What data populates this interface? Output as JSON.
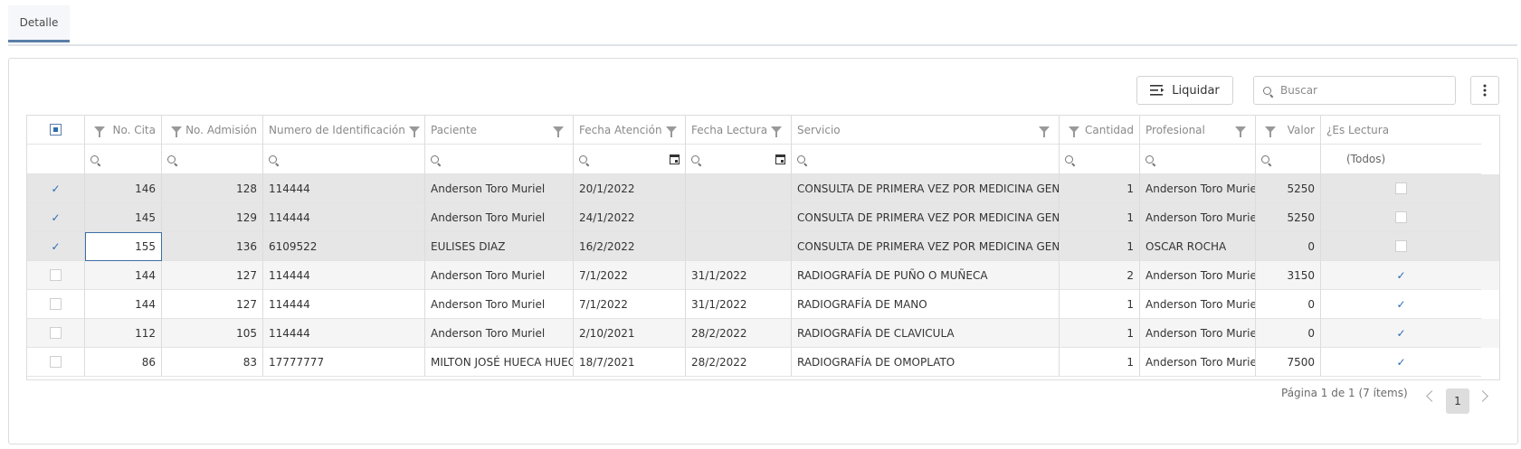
{
  "tabs": [
    {
      "label": "Detalle"
    }
  ],
  "toolbar": {
    "liquidar_label": "Liquidar",
    "search_placeholder": "Buscar"
  },
  "grid": {
    "columns": [
      {
        "key": "select",
        "label": ""
      },
      {
        "key": "cita",
        "label": "No. Cita"
      },
      {
        "key": "admision",
        "label": "No. Admisión"
      },
      {
        "key": "identificacion",
        "label": "Numero de Identificación"
      },
      {
        "key": "paciente",
        "label": "Paciente"
      },
      {
        "key": "fecha_atencion",
        "label": "Fecha Atención"
      },
      {
        "key": "fecha_lectura",
        "label": "Fecha Lectura"
      },
      {
        "key": "servicio",
        "label": "Servicio"
      },
      {
        "key": "cantidad",
        "label": "Cantidad"
      },
      {
        "key": "profesional",
        "label": "Profesional"
      },
      {
        "key": "valor",
        "label": "Valor"
      },
      {
        "key": "es_lectura",
        "label": "¿Es Lectura"
      }
    ],
    "lectura_filter": "(Todos)",
    "rows": [
      {
        "selected": true,
        "cita": "146",
        "admision": "128",
        "identificacion": "114444",
        "paciente": "Anderson Toro Muriel",
        "fecha_atencion": "20/1/2022",
        "fecha_lectura": "",
        "servicio": "CONSULTA DE PRIMERA VEZ POR MEDICINA GENERAL",
        "cantidad": "1",
        "profesional": "Anderson Toro Muriel",
        "valor": "5250",
        "es_lectura": false
      },
      {
        "selected": true,
        "cita": "145",
        "admision": "129",
        "identificacion": "114444",
        "paciente": "Anderson Toro Muriel",
        "fecha_atencion": "24/1/2022",
        "fecha_lectura": "",
        "servicio": "CONSULTA DE PRIMERA VEZ POR MEDICINA GENERAL",
        "cantidad": "1",
        "profesional": "Anderson Toro Muriel",
        "valor": "5250",
        "es_lectura": false
      },
      {
        "selected": true,
        "cita": "155",
        "admision": "136",
        "identificacion": "6109522",
        "paciente": "EULISES DIAZ",
        "fecha_atencion": "16/2/2022",
        "fecha_lectura": "",
        "servicio": "CONSULTA DE PRIMERA VEZ POR MEDICINA GENERAL",
        "cantidad": "1",
        "profesional": "OSCAR ROCHA",
        "valor": "0",
        "es_lectura": false
      },
      {
        "selected": false,
        "cita": "144",
        "admision": "127",
        "identificacion": "114444",
        "paciente": "Anderson Toro Muriel",
        "fecha_atencion": "7/1/2022",
        "fecha_lectura": "31/1/2022",
        "servicio": "RADIOGRAFÍA DE PUÑO O MUÑECA",
        "cantidad": "2",
        "profesional": "Anderson Toro Muriel",
        "valor": "3150",
        "es_lectura": true
      },
      {
        "selected": false,
        "cita": "144",
        "admision": "127",
        "identificacion": "114444",
        "paciente": "Anderson Toro Muriel",
        "fecha_atencion": "7/1/2022",
        "fecha_lectura": "31/1/2022",
        "servicio": "RADIOGRAFÍA DE MANO",
        "cantidad": "1",
        "profesional": "Anderson Toro Muriel",
        "valor": "0",
        "es_lectura": true
      },
      {
        "selected": false,
        "cita": "112",
        "admision": "105",
        "identificacion": "114444",
        "paciente": "Anderson Toro Muriel",
        "fecha_atencion": "2/10/2021",
        "fecha_lectura": "28/2/2022",
        "servicio": "RADIOGRAFÍA DE CLAVICULA",
        "cantidad": "1",
        "profesional": "Anderson Toro Muriel",
        "valor": "0",
        "es_lectura": true
      },
      {
        "selected": false,
        "cita": "86",
        "admision": "83",
        "identificacion": "17777777",
        "paciente": "MILTON JOSÉ HUECA HUECA",
        "fecha_atencion": "18/7/2021",
        "fecha_lectura": "28/2/2022",
        "servicio": "RADIOGRAFÍA DE OMOPLATO",
        "cantidad": "1",
        "profesional": "Anderson Toro Muriel",
        "valor": "7500",
        "es_lectura": true
      }
    ]
  },
  "pager": {
    "info": "Página 1 de 1 (7 ítems)",
    "current_page": "1"
  },
  "colors": {
    "accent": "#2b6cb0",
    "selected_row": "#e6e6e6"
  }
}
